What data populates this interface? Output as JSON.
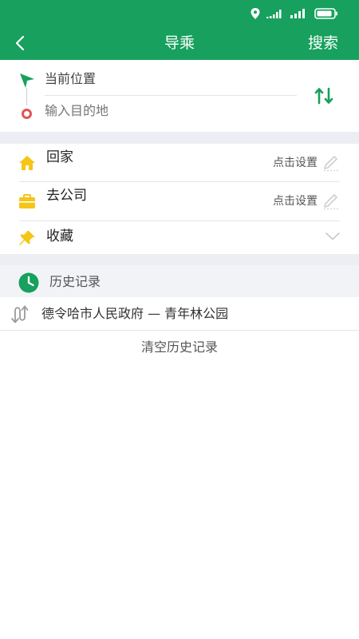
{
  "header": {
    "title": "导乘",
    "search_label": "搜索"
  },
  "route": {
    "start_label": "当前位置",
    "destination_placeholder": "输入目的地"
  },
  "quick": {
    "home_label": "回家",
    "home_action": "点击设置",
    "work_label": "去公司",
    "work_action": "点击设置",
    "favorites_label": "收藏"
  },
  "history": {
    "title": "历史记录",
    "items": [
      {
        "text": "德令哈市人民政府 — 青年林公园"
      }
    ],
    "clear_label": "清空历史记录"
  },
  "colors": {
    "brand": "#17a05e",
    "icon_yellow": "#f5c518",
    "end_red": "#e05454"
  }
}
